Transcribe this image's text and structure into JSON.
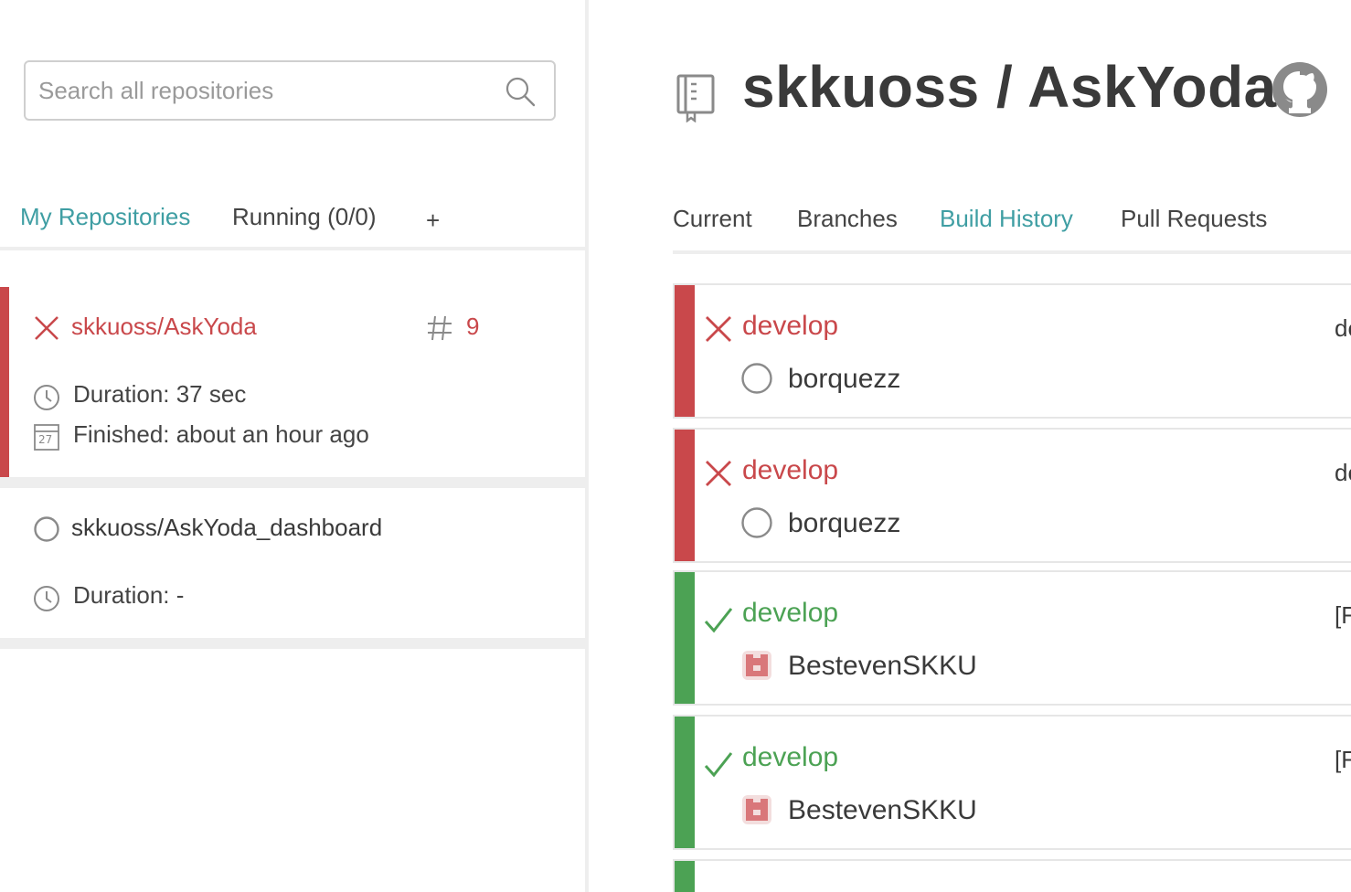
{
  "colors": {
    "failed": "#c9484b",
    "passed": "#4ca254",
    "accent": "#3f9ea3",
    "text": "#3a3a3a",
    "muted": "#9a9a9a"
  },
  "sidebar": {
    "search": {
      "placeholder": "Search all repositories",
      "icon": "search-icon"
    },
    "tabs": [
      {
        "label": "My Repositories",
        "active": true
      },
      {
        "label": "Running (0/0)",
        "active": false
      },
      {
        "label": "+",
        "active": false
      }
    ],
    "repos": [
      {
        "name": "skkuoss/AskYoda",
        "status": "failed",
        "build_number": "9",
        "duration": "Duration: 37 sec",
        "finished": "Finished: about an hour ago",
        "calendar_day": "27"
      },
      {
        "name": "skkuoss/AskYoda_dashboard",
        "status": "none",
        "duration": "Duration: -"
      }
    ]
  },
  "main": {
    "title": "skkuoss / AskYoda",
    "tabs": [
      {
        "label": "Current",
        "active": false
      },
      {
        "label": "Branches",
        "active": false
      },
      {
        "label": "Build History",
        "active": true
      },
      {
        "label": "Pull Requests",
        "active": false
      }
    ],
    "builds": [
      {
        "status": "failed",
        "branch": "develop",
        "author": "borquezz",
        "avatar": "empty-avatar",
        "message": "de"
      },
      {
        "status": "failed",
        "branch": "develop",
        "author": "borquezz",
        "avatar": "empty-avatar",
        "message": "de"
      },
      {
        "status": "passed",
        "branch": "develop",
        "author": "BestevenSKKU",
        "avatar": "identicon-avatar",
        "message": "[F"
      },
      {
        "status": "passed",
        "branch": "develop",
        "author": "BestevenSKKU",
        "avatar": "identicon-avatar",
        "message": "[F"
      },
      {
        "status": "passed"
      }
    ]
  }
}
